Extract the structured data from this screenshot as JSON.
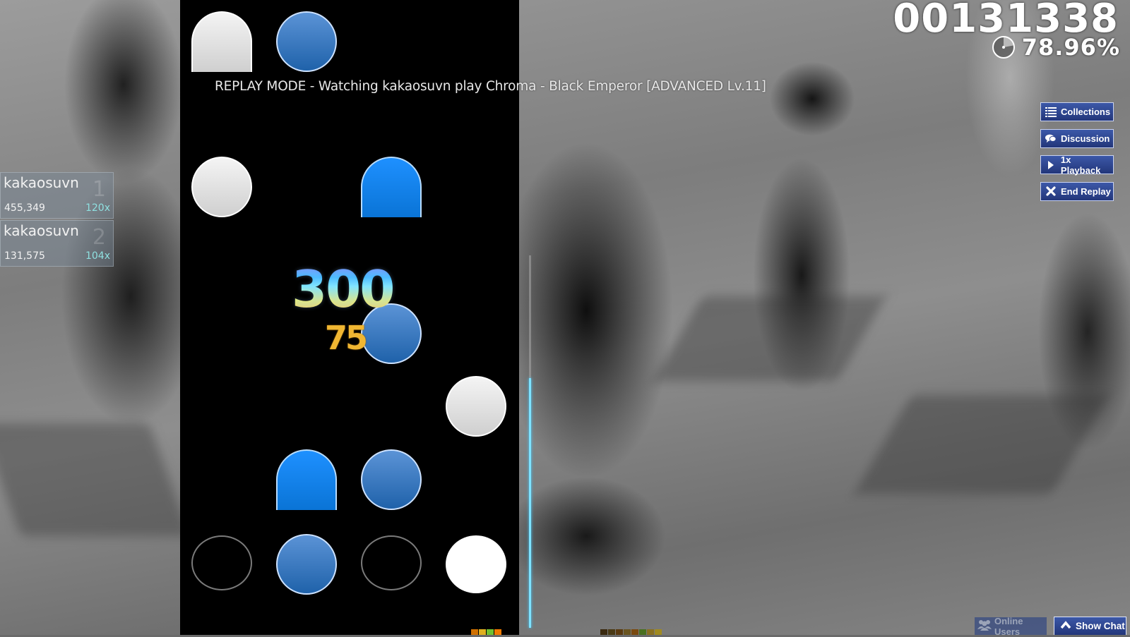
{
  "hud": {
    "score": "00131338",
    "accuracy": "78.96%",
    "song_progress_fraction": 0.22,
    "replay_label": "REPLAY MODE - Watching kakaosuvn play Chroma - Black Emperor [ADVANCED Lv.11]",
    "judgement": "300",
    "combo": "75",
    "map_progress_fraction": 0.67
  },
  "side_buttons": [
    {
      "label": "Collections",
      "icon": "list-icon"
    },
    {
      "label": "Discussion",
      "icon": "speech-bubbles-icon"
    },
    {
      "label": "1x Playback",
      "icon": "play-icon"
    },
    {
      "label": "End Replay",
      "icon": "close-icon"
    }
  ],
  "leaderboard": [
    {
      "name": "kakaosuvn",
      "rank": "1",
      "score": "455,349",
      "combo": "120x"
    },
    {
      "name": "kakaosuvn",
      "rank": "2",
      "score": "131,575",
      "combo": "104x"
    }
  ],
  "bottom_buttons": {
    "online_users": "Online Users",
    "show_chat": "Show Chat"
  },
  "colors": {
    "button_bg": "#2f4690",
    "note_blue": "#2a6fbf",
    "note_light_blue": "#1e90ff",
    "progress": "#7fe3ff",
    "combo": "#f0b632"
  },
  "hit_lights_left": [
    "#d07000",
    "#e0b020",
    "#70c030",
    "#f07a00"
  ],
  "hit_lights_right": [
    "#3a2a10",
    "#4a3a15",
    "#5a3a10",
    "#6a5520",
    "#7a4a10",
    "#4a7020",
    "#8a7020",
    "#a08a20"
  ]
}
